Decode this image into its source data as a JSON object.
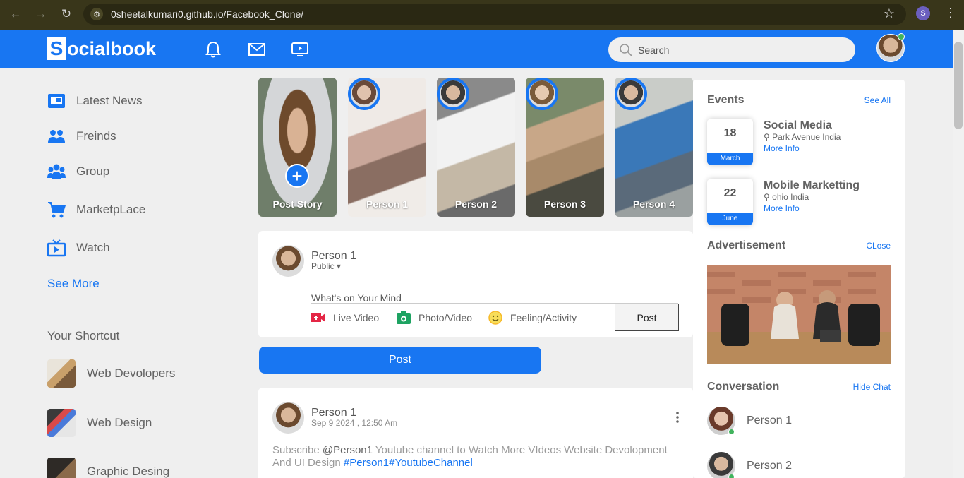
{
  "browser": {
    "url": "0sheetalkumari0.github.io/Facebook_Clone/",
    "profile_initial": "S"
  },
  "header": {
    "logo_letter": "S",
    "logo_text": "ocialbook",
    "search_placeholder": "Search",
    "icons": [
      "bell-icon",
      "mail-icon",
      "video-icon"
    ]
  },
  "sidebar": {
    "items": [
      {
        "label": "Latest News",
        "icon": "news-icon"
      },
      {
        "label": "Freinds",
        "icon": "friends-icon"
      },
      {
        "label": "Group",
        "icon": "group-icon"
      },
      {
        "label": "MarketpLace",
        "icon": "cart-icon"
      },
      {
        "label": "Watch",
        "icon": "tv-icon"
      }
    ],
    "see_more": "See More",
    "shortcut_title": "Your Shortcut",
    "shortcuts": [
      {
        "label": "Web Devolopers"
      },
      {
        "label": "Web Design"
      },
      {
        "label": "Graphic Desing"
      }
    ]
  },
  "stories": [
    {
      "name": "Post Story"
    },
    {
      "name": "Person 1"
    },
    {
      "name": "Person 2"
    },
    {
      "name": "Person 3"
    },
    {
      "name": "Person 4"
    }
  ],
  "composer": {
    "user": "Person 1",
    "privacy": "Public",
    "placeholder": "What's on Your Mind",
    "actions": [
      {
        "label": "Live Video",
        "icon": "live-video-icon",
        "color": "#e42645"
      },
      {
        "label": "Photo/Video",
        "icon": "photo-icon",
        "color": "#1ea362"
      },
      {
        "label": "Feeling/Activity",
        "icon": "feeling-icon",
        "color": "#f7b928"
      }
    ],
    "post_label": "Post",
    "big_post_label": "Post"
  },
  "post": {
    "user": "Person 1",
    "time": "Sep 9 2024 , 12:50 Am",
    "text_before": "Subscribe ",
    "mention": "@Person1",
    "text_after": " Youtube channel to Watch More VIdeos Website Devolopment And UI Design ",
    "hashtags": "#Person1#YoutubeChannel"
  },
  "right": {
    "events_title": "Events",
    "events_link": "See All",
    "events": [
      {
        "day": "18",
        "month": "March",
        "title": "Social Media",
        "location": "Park Avenue India",
        "more": "More Info"
      },
      {
        "day": "22",
        "month": "June",
        "title": "Mobile Marketting",
        "location": "ohio India",
        "more": "More Info"
      }
    ],
    "ad_title": "Advertisement",
    "ad_link": "CLose",
    "conv_title": "Conversation",
    "conv_link": "Hide Chat",
    "conversations": [
      {
        "name": "Person 1"
      },
      {
        "name": "Person 2"
      }
    ]
  },
  "colors": {
    "brand": "#1876f2",
    "online": "#41b35d"
  }
}
